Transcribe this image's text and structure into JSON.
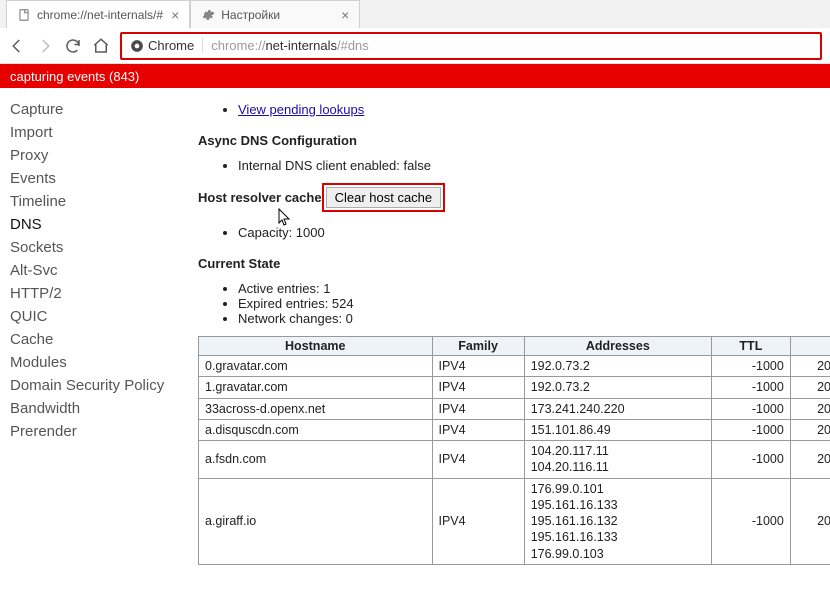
{
  "tabs": [
    {
      "title": "chrome://net-internals/#",
      "active": true,
      "favicon": "page"
    },
    {
      "title": "Настройки",
      "active": false,
      "favicon": "gear"
    }
  ],
  "address_bar": {
    "chip_label": "Chrome",
    "url_muted": "chrome://",
    "url_bold": "net-internals",
    "url_tail": "/#dns"
  },
  "banner": "capturing events (843)",
  "sidebar": {
    "items": [
      "Capture",
      "Import",
      "Proxy",
      "Events",
      "Timeline",
      "DNS",
      "Sockets",
      "Alt-Svc",
      "HTTP/2",
      "QUIC",
      "Cache",
      "Modules",
      "Domain Security Policy",
      "Bandwidth",
      "Prerender"
    ],
    "active_index": 5
  },
  "content": {
    "pending_link": "View pending lookups",
    "async_heading": "Async DNS Configuration",
    "async_item": "Internal DNS client enabled: false",
    "cache_label": "Host resolver cache",
    "clear_button": "Clear host cache",
    "capacity_item": "Capacity: 1000",
    "state_heading": "Current State",
    "state_items": [
      "Active entries: 1",
      "Expired entries: 524",
      "Network changes: 0"
    ],
    "table": {
      "headers": [
        "Hostname",
        "Family",
        "Addresses",
        "TTL",
        ""
      ],
      "rows": [
        {
          "host": "0.gravatar.com",
          "family": "IPV4",
          "addresses": "192.0.73.2",
          "ttl": "-1000",
          "extra": "20"
        },
        {
          "host": "1.gravatar.com",
          "family": "IPV4",
          "addresses": "192.0.73.2",
          "ttl": "-1000",
          "extra": "20"
        },
        {
          "host": "33across-d.openx.net",
          "family": "IPV4",
          "addresses": "173.241.240.220",
          "ttl": "-1000",
          "extra": "20"
        },
        {
          "host": "a.disquscdn.com",
          "family": "IPV4",
          "addresses": "151.101.86.49",
          "ttl": "-1000",
          "extra": "20"
        },
        {
          "host": "a.fsdn.com",
          "family": "IPV4",
          "addresses": "104.20.117.11\n104.20.116.11",
          "ttl": "-1000",
          "extra": "20"
        },
        {
          "host": "a.giraff.io",
          "family": "IPV4",
          "addresses": "176.99.0.101\n195.161.16.133\n195.161.16.132\n195.161.16.133\n176.99.0.103",
          "ttl": "-1000",
          "extra": "20"
        }
      ]
    }
  }
}
